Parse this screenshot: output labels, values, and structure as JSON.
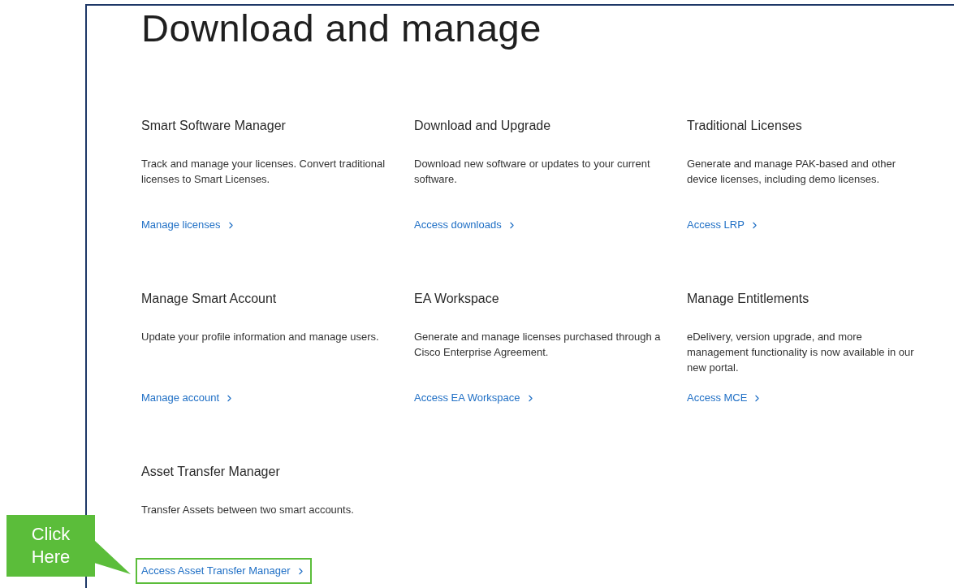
{
  "page": {
    "title": "Download and manage"
  },
  "sections": [
    {
      "title": "Smart Software Manager",
      "description": "Track and manage your licenses. Convert traditional licenses to Smart Licenses.",
      "link": "Manage licenses",
      "highlighted": false
    },
    {
      "title": "Download and Upgrade",
      "description": "Download new software or updates to your current software.",
      "link": "Access downloads",
      "highlighted": false
    },
    {
      "title": "Traditional Licenses",
      "description": "Generate and manage PAK-based and other device licenses, including demo licenses.",
      "link": "Access LRP",
      "highlighted": false
    },
    {
      "title": "Manage Smart Account",
      "description": "Update your profile information and manage users.",
      "link": "Manage account",
      "highlighted": false
    },
    {
      "title": "EA Workspace",
      "description": "Generate and manage licenses purchased through a Cisco Enterprise Agreement.",
      "link": "Access EA Workspace",
      "highlighted": false
    },
    {
      "title": "Manage Entitlements",
      "description": "eDelivery, version upgrade, and more management functionality is now available in our new portal.",
      "link": "Access MCE",
      "highlighted": false
    },
    {
      "title": "Asset Transfer Manager",
      "description": "Transfer Assets between two smart accounts.",
      "link": "Access Asset Transfer Manager",
      "highlighted": true
    }
  ],
  "callout": {
    "text": "Click Here"
  }
}
